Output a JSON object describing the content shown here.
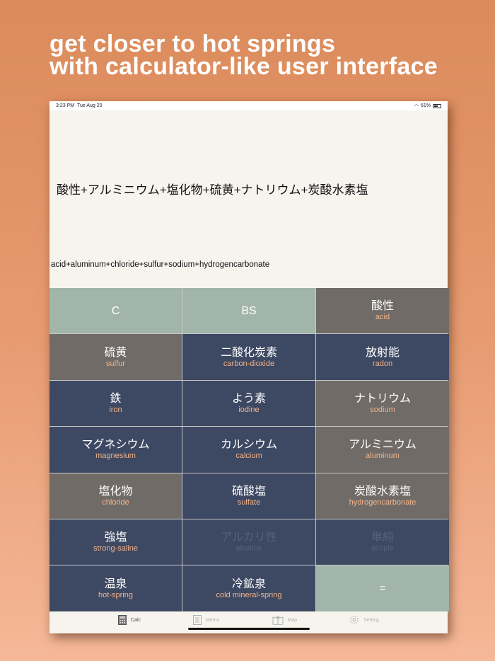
{
  "headline": [
    "get closer to hot springs",
    "with calculator-like user interface"
  ],
  "status": {
    "time": "3:23 PM",
    "date": "Tue Aug 20",
    "battery": "61%"
  },
  "display": {
    "japanese": "酸性+アルミニウム+塩化物+硫黄+ナトリウム+炭酸水素塩",
    "english": "acid+aluminum+chloride+sulfur+sodium+hydrogencarbonate"
  },
  "keys": [
    {
      "m": "C",
      "s": "",
      "c": "g"
    },
    {
      "m": "BS",
      "s": "",
      "c": "g"
    },
    {
      "m": "酸性",
      "s": "acid",
      "c": "d"
    },
    {
      "m": "硫黄",
      "s": "sulfur",
      "c": "d"
    },
    {
      "m": "二酸化炭素",
      "s": "carbon-dioxide",
      "c": "n"
    },
    {
      "m": "放射能",
      "s": "radon",
      "c": "n"
    },
    {
      "m": "鉄",
      "s": "iron",
      "c": "n"
    },
    {
      "m": "よう素",
      "s": "iodine",
      "c": "n"
    },
    {
      "m": "ナトリウム",
      "s": "sodium",
      "c": "d"
    },
    {
      "m": "マグネシウム",
      "s": "magnesium",
      "c": "n"
    },
    {
      "m": "カルシウム",
      "s": "calcium",
      "c": "n"
    },
    {
      "m": "アルミニウム",
      "s": "aluminum",
      "c": "d"
    },
    {
      "m": "塩化物",
      "s": "chloride",
      "c": "d"
    },
    {
      "m": "硫酸塩",
      "s": "sulfate",
      "c": "n"
    },
    {
      "m": "炭酸水素塩",
      "s": "hydrogencarbonate",
      "c": "d"
    },
    {
      "m": "強塩",
      "s": "strong-saline",
      "c": "n"
    },
    {
      "m": "アルカリ性",
      "s": "alkaline",
      "c": "n dis"
    },
    {
      "m": "単純",
      "s": "simple",
      "c": "n dis"
    },
    {
      "m": "温泉",
      "s": "hot-spring",
      "c": "n"
    },
    {
      "m": "冷鉱泉",
      "s": "cold mineral-spring",
      "c": "n"
    },
    {
      "m": "=",
      "s": "",
      "c": "g"
    }
  ],
  "tabs": [
    {
      "label": "Calc",
      "icon": "calculator-icon"
    },
    {
      "label": "Memo",
      "icon": "memo-icon"
    },
    {
      "label": "Map",
      "icon": "map-icon"
    },
    {
      "label": "Setting",
      "icon": "gear-icon"
    }
  ]
}
